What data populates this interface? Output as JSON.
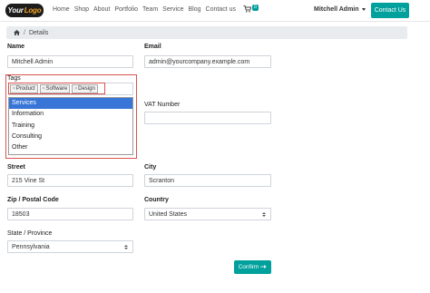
{
  "header": {
    "logo_text": "Your",
    "logo_accent": "Logo",
    "nav": [
      "Home",
      "Shop",
      "About",
      "Portfolio",
      "Team",
      "Service",
      "Blog",
      "Contact us"
    ],
    "cart_count": "0",
    "user_name": "Mitchell Admin",
    "contact_button": "Contact Us"
  },
  "breadcrumb": {
    "home_icon": "home-icon",
    "separator": "/",
    "current": "Details"
  },
  "form": {
    "name": {
      "label": "Name",
      "value": "Mitchell Admin"
    },
    "email": {
      "label": "Email",
      "value": "admin@yourcompany.example.com"
    },
    "tags": {
      "label": "Tags",
      "selected": [
        "Product",
        "Software",
        "Design"
      ],
      "remove_glyph": "×",
      "options": [
        "Services",
        "Information",
        "Training",
        "Consulting",
        "Other"
      ],
      "highlighted": "Services"
    },
    "vat": {
      "label": "VAT Number",
      "value": ""
    },
    "street": {
      "label": "Street",
      "value": "215 Vine St"
    },
    "city": {
      "label": "City",
      "value": "Scranton"
    },
    "zip": {
      "label": "Zip / Postal Code",
      "value": "18503"
    },
    "country": {
      "label": "Country",
      "value": "United States"
    },
    "state": {
      "label": "State / Province",
      "value": "Pennsylvania"
    },
    "confirm_button": "Confirm"
  },
  "colors": {
    "accent": "#00a09d",
    "highlight_outline": "#d9534f",
    "dropdown_selected": "#3875d7"
  }
}
